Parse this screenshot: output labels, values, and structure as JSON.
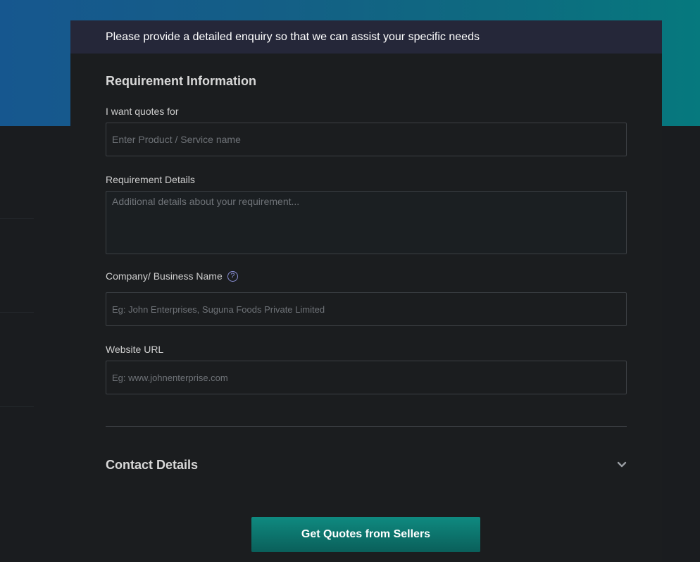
{
  "header": {
    "text": "Please provide a detailed enquiry so that we can assist your specific needs"
  },
  "requirement": {
    "title": "Requirement Information",
    "quotes_label": "I want quotes for",
    "quotes_placeholder": "Enter Product / Service name",
    "details_label": "Requirement Details",
    "details_placeholder": "Additional details about your requirement...",
    "company_label": "Company/ Business Name",
    "company_placeholder": "Eg: John Enterprises, Suguna Foods Private Limited",
    "website_label": "Website URL",
    "website_placeholder": "Eg: www.johnenterprise.com",
    "help_glyph": "?"
  },
  "contact": {
    "title": "Contact Details",
    "icon": "chevron-down-icon"
  },
  "submit": {
    "label": "Get Quotes from Sellers"
  },
  "colors": {
    "accent": "#0f8a80",
    "header_bg": "#252739",
    "card_bg": "#1b1d1f"
  }
}
